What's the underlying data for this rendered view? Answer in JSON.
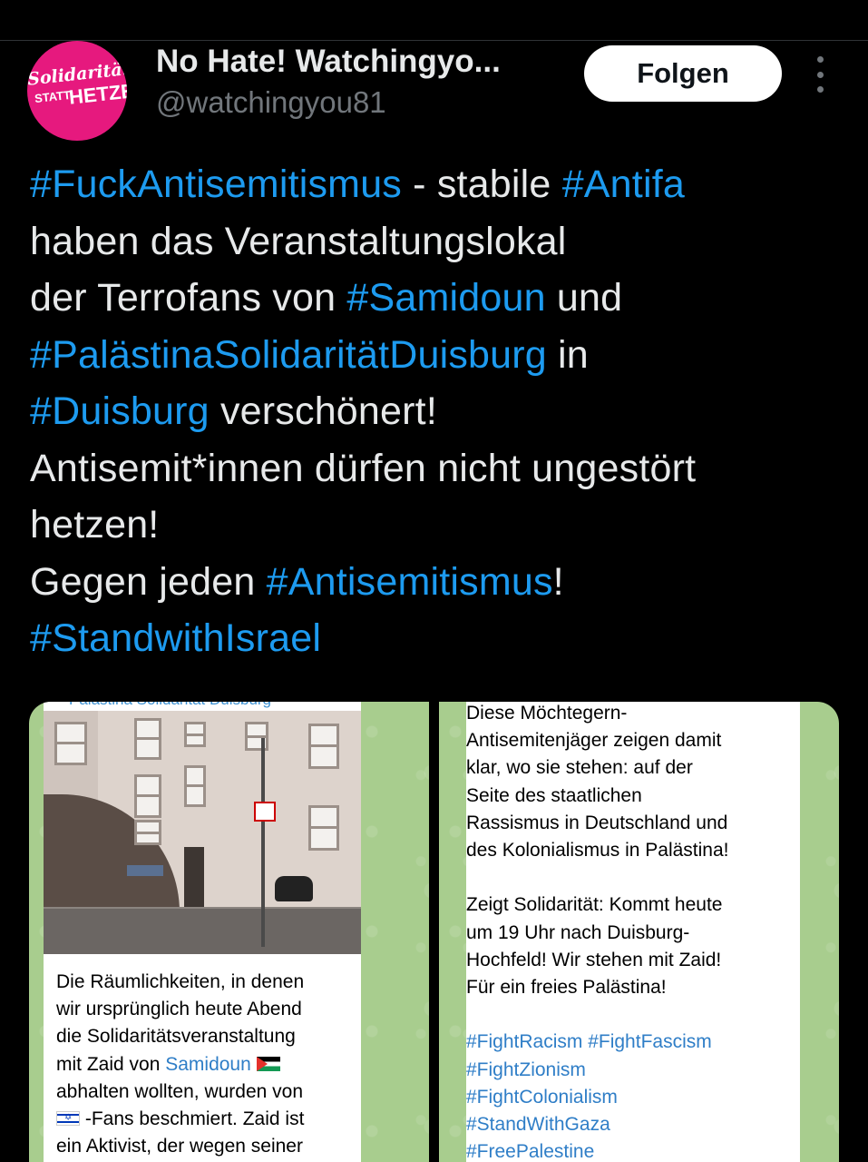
{
  "account": {
    "display_name": "No Hate! Watchingyo...",
    "handle": "@watchingyou81",
    "avatar_text_1": "Solidarität",
    "avatar_text_2": "STATT",
    "avatar_text_3": "HETZE",
    "avatar_color": "#e6197e"
  },
  "actions": {
    "follow_label": "Folgen",
    "more_icon": "more-vertical-icon"
  },
  "tweet": {
    "line1": {
      "tag1": "#FuckAntisemitismus",
      "text1": " - stabile ",
      "tag2": "#Antifa"
    },
    "line2": "haben das Veranstaltungslokal",
    "line3": {
      "text1": "der Terrofans von ",
      "tag1": "#Samidoun",
      "text2": " und"
    },
    "line4": {
      "tag1": "#PalästinaSolidaritätDuisburg",
      "text1": " in"
    },
    "line5": {
      "tag1": "#Duisburg",
      "text1": " verschönert!"
    },
    "line6": "Antisemit*innen dürfen nicht ungestört",
    "line7": "hetzen!",
    "line8": {
      "text1": "Gegen jeden ",
      "tag1": "#Antisemitismus",
      "text2": "!"
    },
    "line9": {
      "tag1": "#StandwithIsrael"
    }
  },
  "media_left": {
    "channel_name": "Palästina Solidarität Duisburg",
    "caption": {
      "l1": "Die Räumlichkeiten, in denen",
      "l2": "wir ursprünglich heute Abend",
      "l3": "die Solidaritätsveranstaltung",
      "l4_pre": "mit Zaid von ",
      "l4_link": "Samidoun",
      "l5": "abhalten wollten, wurden von",
      "l6_post": " -Fans beschmiert. Zaid ist",
      "l7": "ein Aktivist, der wegen seiner"
    }
  },
  "media_right": {
    "caption": {
      "l1": "Diese Möchtegern-",
      "l2": "Antisemitenjäger zeigen damit",
      "l3": "klar, wo sie stehen: auf der",
      "l4": "Seite des staatlichen",
      "l5": "Rassismus in Deutschland und",
      "l6": "des Kolonialismus in Palästina!",
      "l7": "Zeigt Solidarität: Kommt heute",
      "l8": "um 19 Uhr nach Duisburg-",
      "l9": "Hochfeld! Wir stehen mit Zaid!",
      "l10": "Für ein freies Palästina!",
      "hashtags": [
        "#FightRacism #FightFascism",
        "#FightZionism",
        "#FightColonialism",
        "#StandWithGaza",
        "#FreePalestine"
      ]
    }
  },
  "colors": {
    "background": "#000000",
    "text": "#e7e9ea",
    "secondary_text": "#71767b",
    "hashtag": "#1d9bf0",
    "telegram_bg": "#a8cd8e",
    "telegram_link": "#2f7ec7"
  }
}
